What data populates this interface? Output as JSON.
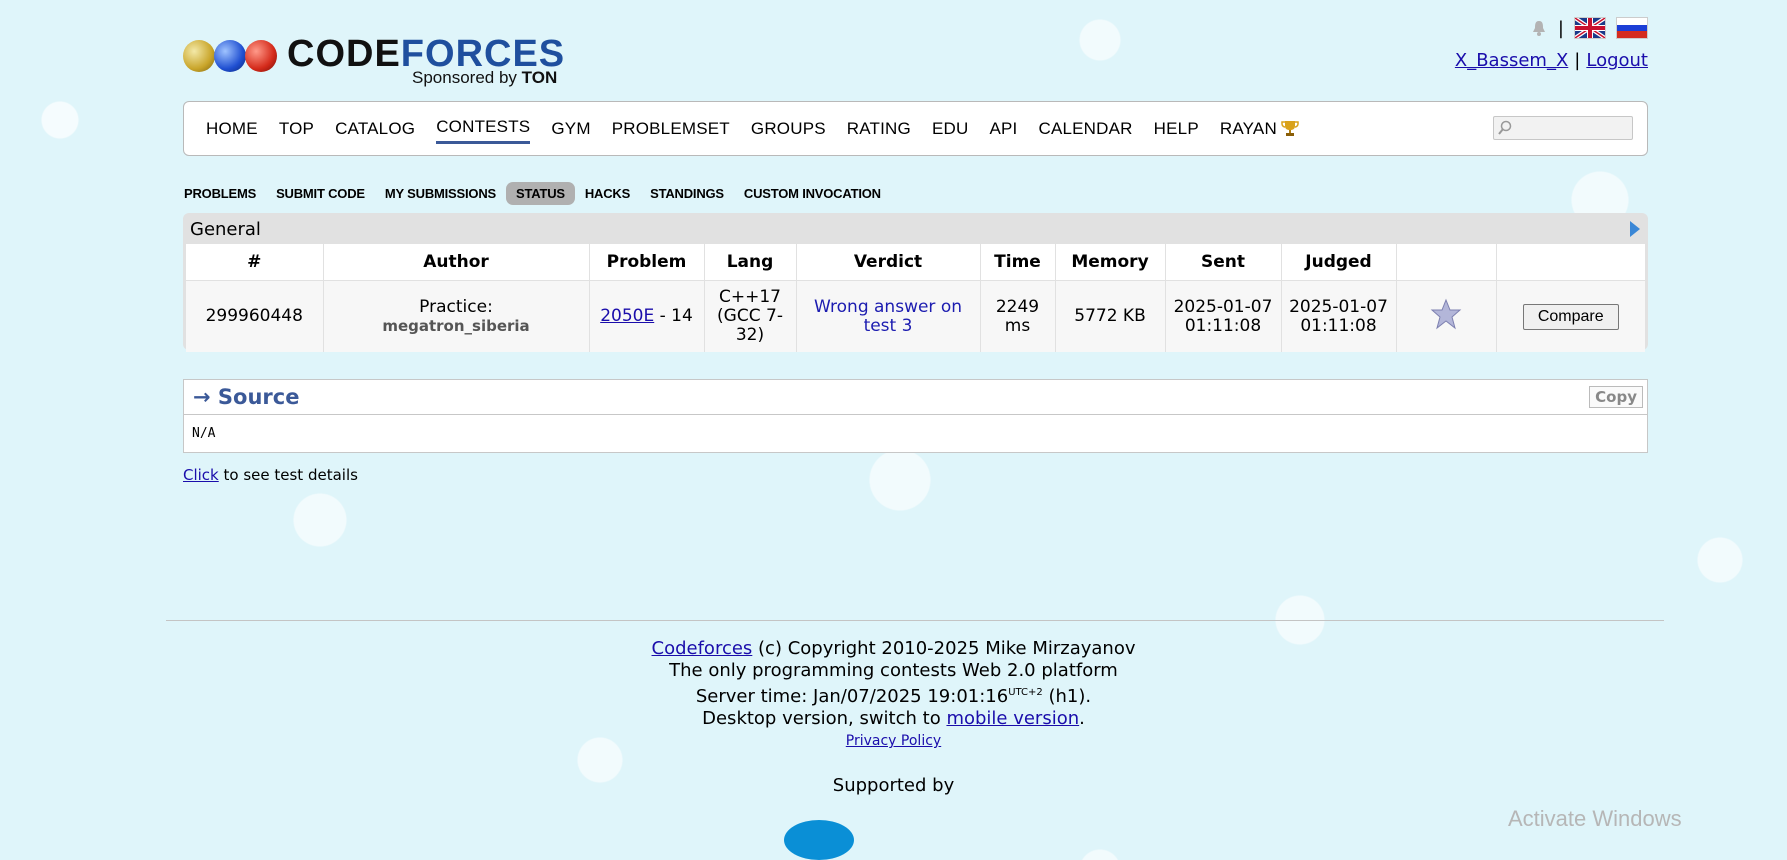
{
  "header": {
    "logo_main": "CODE",
    "logo_accent": "FORCES",
    "sponsor_prefix": "Sponsored by ",
    "sponsor_name": "TON",
    "username": "X_Bassem_X",
    "logout": "Logout",
    "separator": "|"
  },
  "menu": {
    "items": [
      "HOME",
      "TOP",
      "CATALOG",
      "CONTESTS",
      "GYM",
      "PROBLEMSET",
      "GROUPS",
      "RATING",
      "EDU",
      "API",
      "CALENDAR",
      "HELP",
      "RAYAN"
    ],
    "active": "CONTESTS"
  },
  "subtabs": {
    "items": [
      "PROBLEMS",
      "SUBMIT CODE",
      "MY SUBMISSIONS",
      "STATUS",
      "HACKS",
      "STANDINGS",
      "CUSTOM INVOCATION"
    ],
    "active": "STATUS"
  },
  "general": {
    "title": "General",
    "headers": [
      "#",
      "Author",
      "Problem",
      "Lang",
      "Verdict",
      "Time",
      "Memory",
      "Sent",
      "Judged",
      "",
      ""
    ],
    "row": {
      "id": "299960448",
      "author_label": "Practice:",
      "author_name": "megatron_siberia",
      "problem_link": "2050E",
      "problem_suffix": " - 14",
      "lang": "C++17 (GCC 7-32)",
      "verdict": "Wrong answer on test 3",
      "time": "2249 ms",
      "memory": "5772 KB",
      "sent": "2025-01-07 01:11:08",
      "judged": "2025-01-07 01:11:08",
      "compare": "Compare"
    }
  },
  "source": {
    "title": "→ Source",
    "copy": "Copy",
    "content": "N/A"
  },
  "details": {
    "link": "Click",
    "text": " to see test details"
  },
  "footer": {
    "brand": "Codeforces",
    "copyright": " (c) Copyright 2010-2025 Mike Mirzayanov",
    "tagline": "The only programming contests Web 2.0 platform",
    "server_time_prefix": "Server time: Jan/07/2025 19:01:16",
    "server_time_tz": "UTC+2",
    "server_time_suffix": " (h1).",
    "desktop_prefix": "Desktop version, switch to ",
    "mobile_link": "mobile version",
    "desktop_suffix": ".",
    "privacy": "Privacy Policy",
    "supported_by": "Supported by"
  },
  "watermark": "Activate Windows",
  "colors": {
    "brand_blue": "#1f4f9e",
    "verdict_blue": "#1c1cb0",
    "background": "#dff5fa"
  }
}
